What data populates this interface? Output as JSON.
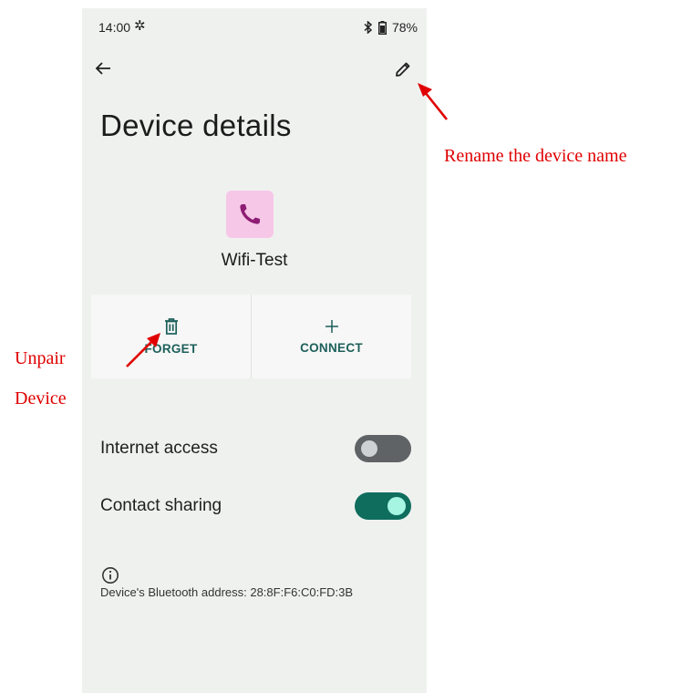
{
  "status_bar": {
    "time": "14:00",
    "battery": "78%"
  },
  "page": {
    "title": "Device details"
  },
  "device": {
    "name": "Wifi-Test"
  },
  "actions": [
    {
      "label": "FORGET",
      "icon": "trash-icon"
    },
    {
      "label": "CONNECT",
      "icon": "plus-icon"
    }
  ],
  "settings": [
    {
      "label": "Internet access",
      "enabled": false
    },
    {
      "label": "Contact sharing",
      "enabled": true
    }
  ],
  "footer": {
    "bluetooth_address": "Device's Bluetooth address: 28:8F:F6:C0:FD:3B"
  },
  "annotations": {
    "rename": "Rename the device name",
    "unpair_line1": "Unpair",
    "unpair_line2": "Device"
  },
  "colors": {
    "accent": "#0f6d5e",
    "icon_bg": "#f6c7e7",
    "annotation": "#e00000"
  }
}
